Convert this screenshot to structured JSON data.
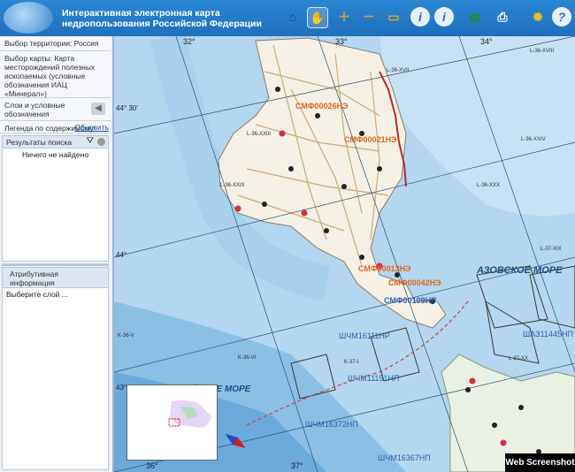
{
  "header": {
    "title_line1": "Интерактивная электронная карта",
    "title_line2": "недропользования Российской Федерации"
  },
  "toolbar": [
    {
      "name": "home-icon",
      "glyph": "⌂",
      "color": "#1a3f7a"
    },
    {
      "name": "pan-hand-icon",
      "glyph": "✋",
      "color": "#ffffff"
    },
    {
      "name": "zoom-in-icon",
      "glyph": "＋",
      "color": "#e0a020"
    },
    {
      "name": "zoom-out-icon",
      "glyph": "－",
      "color": "#e0a020"
    },
    {
      "name": "measure-icon",
      "glyph": "▭",
      "color": "#e0a020"
    },
    {
      "name": "info-icon",
      "glyph": "i",
      "color": "#2a6fd0"
    },
    {
      "name": "info-alt-icon",
      "glyph": "i",
      "color": "#2a6fd0"
    },
    {
      "name": "globe-icon",
      "glyph": "◍",
      "color": "#1f8a3a"
    },
    {
      "name": "print-icon",
      "glyph": "⎙",
      "color": "#ffffff"
    },
    {
      "name": "settings-icon",
      "glyph": "✹",
      "color": "#f0c020"
    },
    {
      "name": "help-icon",
      "glyph": "?",
      "color": "#2a6fd0"
    }
  ],
  "sidebar": {
    "territory": "Выбор территории: Россия",
    "map_choice": "Выбор карты: Карта месторождений полезных ископаемых (условные обозначения ИАЦ «Минерал»)",
    "layers": "Слои и условные обозначения",
    "legend": "Легенда по содержимому",
    "refresh": "Обновить",
    "search_header": "Результаты поиска",
    "search_result": "Ничего не найдено",
    "attr_header": "Атрибутивная информация",
    "attr_prompt": "Выберите слой ..."
  },
  "map": {
    "coords": [
      "32°",
      "33°",
      "34°",
      "44° 30'",
      "44°",
      "43° 30'",
      "43°",
      "36°",
      "37°"
    ],
    "sea_azov": "АЗОВСКОЕ МОРЕ",
    "sea_black": "ЧЁРНОЕ МОРЕ",
    "licenses_red": [
      "СМФ00026НЭ",
      "СМФ00021НЭ",
      "СМФ00013НЭ",
      "СМФ00042НЭ"
    ],
    "licenses_blue": [
      "СМФ00109НР",
      "ШЧМ16111НР",
      "ШЧМ11151НП",
      "ШЧМ16372НП",
      "ШЧМ16367НП",
      "ШАЗ11445НП"
    ],
    "grid_labels": [
      "L-36-XVII",
      "L-36-XVIII",
      "L-36-XXIII",
      "L-36-XXIV",
      "L-36-XXIX",
      "L-36-XXX",
      "L-37-XIX",
      "L-37-XX",
      "K-36-V",
      "K-36-VI",
      "K-37-I"
    ]
  },
  "watermark": "Web Screenshot"
}
